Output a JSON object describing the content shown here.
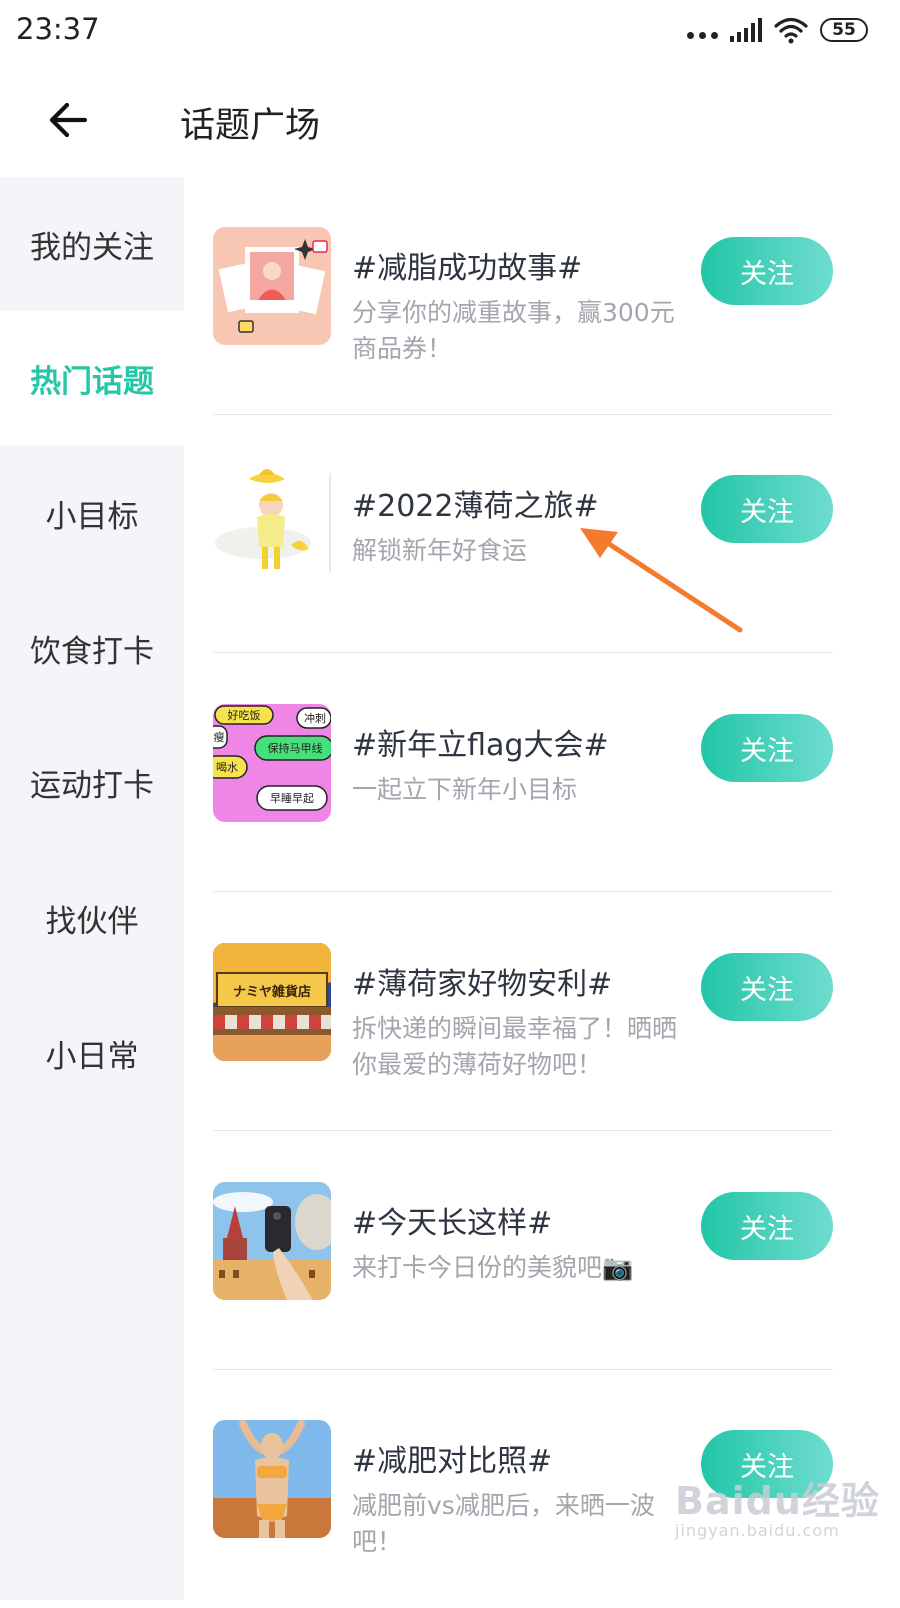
{
  "status": {
    "time": "23:37",
    "battery": "55"
  },
  "header": {
    "title": "话题广场",
    "back_icon": "arrow-left-icon"
  },
  "sidebar": {
    "items": [
      {
        "label": "我的关注",
        "active": false
      },
      {
        "label": "热门话题",
        "active": true
      },
      {
        "label": "小目标",
        "active": false
      },
      {
        "label": "饮食打卡",
        "active": false
      },
      {
        "label": "运动打卡",
        "active": false
      },
      {
        "label": "找伙伴",
        "active": false
      },
      {
        "label": "小日常",
        "active": false
      }
    ]
  },
  "topics": [
    {
      "title": "#减脂成功故事#",
      "desc": "分享你的减重故事，赢300元商品券！",
      "follow_label": "关注"
    },
    {
      "title": "#2022薄荷之旅#",
      "desc": "解锁新年好食运",
      "follow_label": "关注"
    },
    {
      "title": "#新年立flag大会#",
      "desc": "一起立下新年小目标",
      "follow_label": "关注"
    },
    {
      "title": "#薄荷家好物安利#",
      "desc": "拆快递的瞬间最幸福了！晒晒你最爱的薄荷好物吧！",
      "follow_label": "关注"
    },
    {
      "title": "#今天长这样#",
      "desc": "来打卡今日份的美貌吧📷",
      "follow_label": "关注"
    },
    {
      "title": "#减肥对比照#",
      "desc": "减肥前vs减肥后，来晒一波吧！",
      "follow_label": "关注"
    }
  ],
  "flag_bubbles": [
    "好吃饭",
    "冲刺",
    "保持马甲线",
    "喝水",
    "早睡早起",
    "瘦"
  ],
  "shop_sign": "ナミヤ雑貨店",
  "watermark": {
    "main": "Baidu经验",
    "sub": "jingyan.baidu.com"
  },
  "colors": {
    "accent": "#26c6a6",
    "button_start": "#22c6a7",
    "button_end": "#6fdcd0",
    "arrow": "#f47a2e",
    "sidebar_bg": "#f4f5f9"
  }
}
